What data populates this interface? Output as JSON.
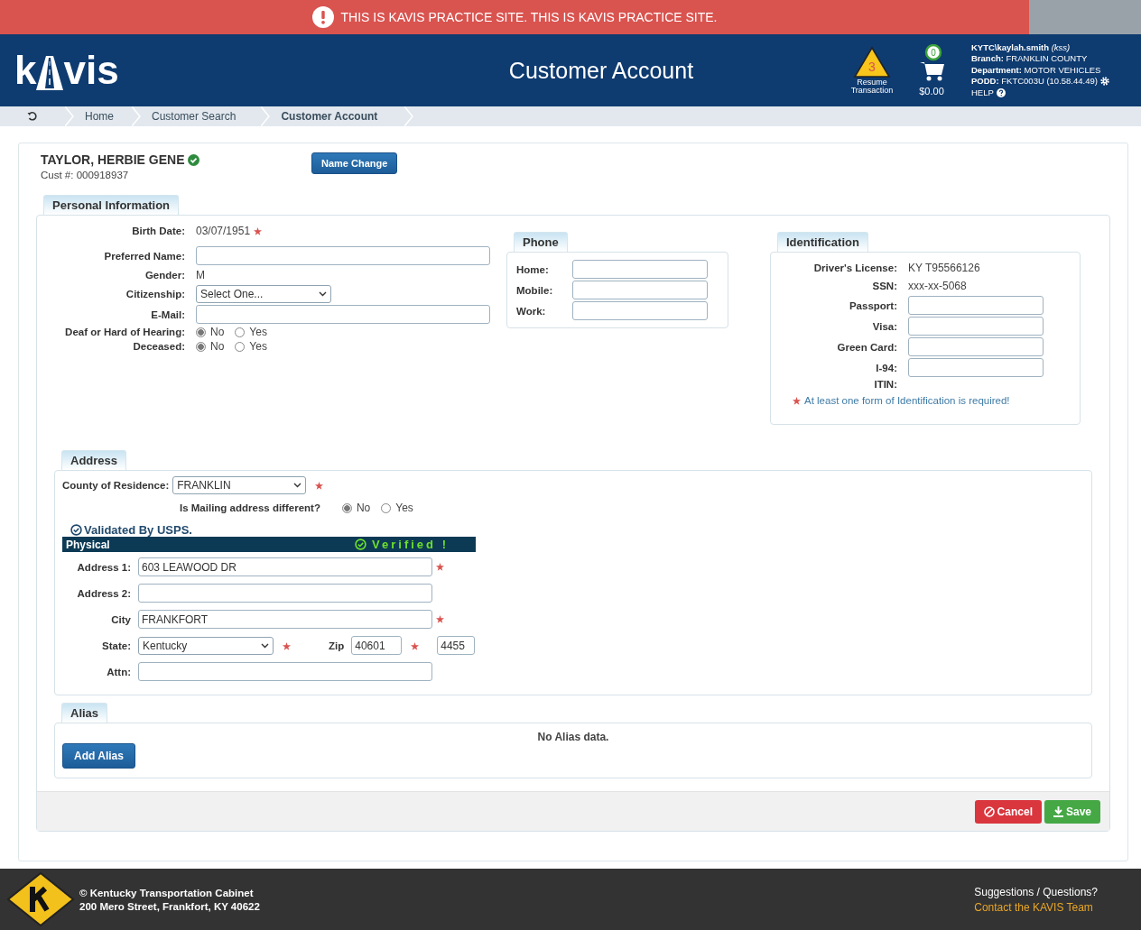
{
  "banner": {
    "text": "THIS IS KAVIS PRACTICE SITE. THIS IS KAVIS PRACTICE SITE."
  },
  "header": {
    "logo": {
      "left": "k",
      "right": "vis"
    },
    "title": "Customer Account",
    "resume": {
      "count": "3",
      "label": "Resume Transaction"
    },
    "cart": {
      "count": "0",
      "amount": "$0.00"
    },
    "user_lines": [
      "**KYTC\\kaylah.smith** *(kss)*",
      "**Branch:** FRANKLIN COUNTY",
      "**Department:** MOTOR VEHICLES",
      "**PODD:** FKTC003U (10.58.44.49)"
    ],
    "help": "HELP"
  },
  "breadcrumb": [
    {
      "label": "Home",
      "selected": false
    },
    {
      "label": "Customer Search",
      "selected": false
    },
    {
      "label": "Customer Account",
      "selected": true
    }
  ],
  "customer": {
    "name": "TAYLOR, HERBIE GENE",
    "verified": true,
    "number": "Cust #: 000918937",
    "name_change": "Name Change"
  },
  "personal": {
    "title": "Personal Information",
    "fields": [
      {
        "kind": "static",
        "label": "Birth Date:",
        "value": "03/07/1951",
        "required": true
      },
      {
        "kind": "text",
        "label": "Preferred Name:"
      },
      {
        "kind": "static",
        "label": "Gender:",
        "value": "M"
      },
      {
        "kind": "select",
        "label": "Citizenship:",
        "value": "Select One..."
      },
      {
        "kind": "text",
        "label": "E-Mail:"
      },
      {
        "kind": "radio",
        "label": "Deaf or Hard of Hearing:",
        "options": [
          {
            "label": "No",
            "selected": true
          },
          {
            "label": "Yes",
            "selected": false
          }
        ]
      },
      {
        "kind": "radio",
        "label": "Deceased:",
        "options": [
          {
            "label": "No",
            "selected": true
          },
          {
            "label": "Yes",
            "selected": false
          }
        ]
      }
    ]
  },
  "phone": {
    "title": "Phone",
    "fields": [
      {
        "label": "Home:"
      },
      {
        "label": "Mobile:"
      },
      {
        "label": "Work:"
      }
    ]
  },
  "identification": {
    "title": "Identification",
    "fields": [
      {
        "kind": "static",
        "label": "Driver's License:",
        "value": "KY T95566126"
      },
      {
        "kind": "static",
        "label": "SSN:",
        "value": "xxx-xx-5068"
      },
      {
        "kind": "text",
        "label": "Passport:"
      },
      {
        "kind": "text",
        "label": "Visa:"
      },
      {
        "kind": "text",
        "label": "Green Card:"
      },
      {
        "kind": "text",
        "label": "I-94:"
      },
      {
        "kind": "label",
        "label": "ITIN:"
      }
    ],
    "note": "At least one form of Identification is required!"
  },
  "address": {
    "title": "Address",
    "county": {
      "label": "County of Residence:",
      "value": "FRANKLIN",
      "required": true
    },
    "mailing": {
      "label": "Is Mailing address different?",
      "options": [
        {
          "label": "No",
          "selected": true
        },
        {
          "label": "Yes",
          "selected": false
        }
      ]
    },
    "validated": "Validated By USPS.",
    "bar": {
      "title": "Physical",
      "status": "Verified !"
    },
    "rows": [
      {
        "kind": "text",
        "label": "Address 1:",
        "value": "603 LEAWOOD DR",
        "required": true
      },
      {
        "kind": "text",
        "label": "Address 2:"
      },
      {
        "kind": "text",
        "label": "City",
        "value": "FRANKFORT",
        "required": true
      },
      {
        "kind": "state_zip",
        "label": "State:",
        "value": "Kentucky",
        "required": true,
        "zip_label": "Zip",
        "zip": "40601",
        "zip_required": true,
        "zip4": "4455"
      },
      {
        "kind": "text",
        "label": "Attn:"
      }
    ]
  },
  "alias": {
    "title": "Alias",
    "empty": "No Alias data.",
    "button": "Add Alias"
  },
  "actions": {
    "cancel": "Cancel",
    "save": "Save"
  },
  "footer": {
    "lines": [
      "© Kentucky Transportation Cabinet",
      "200 Mero Street, Frankfort, KY 40622"
    ],
    "question": "Suggestions / Questions?",
    "contact": "Contact the KAVIS Team"
  }
}
